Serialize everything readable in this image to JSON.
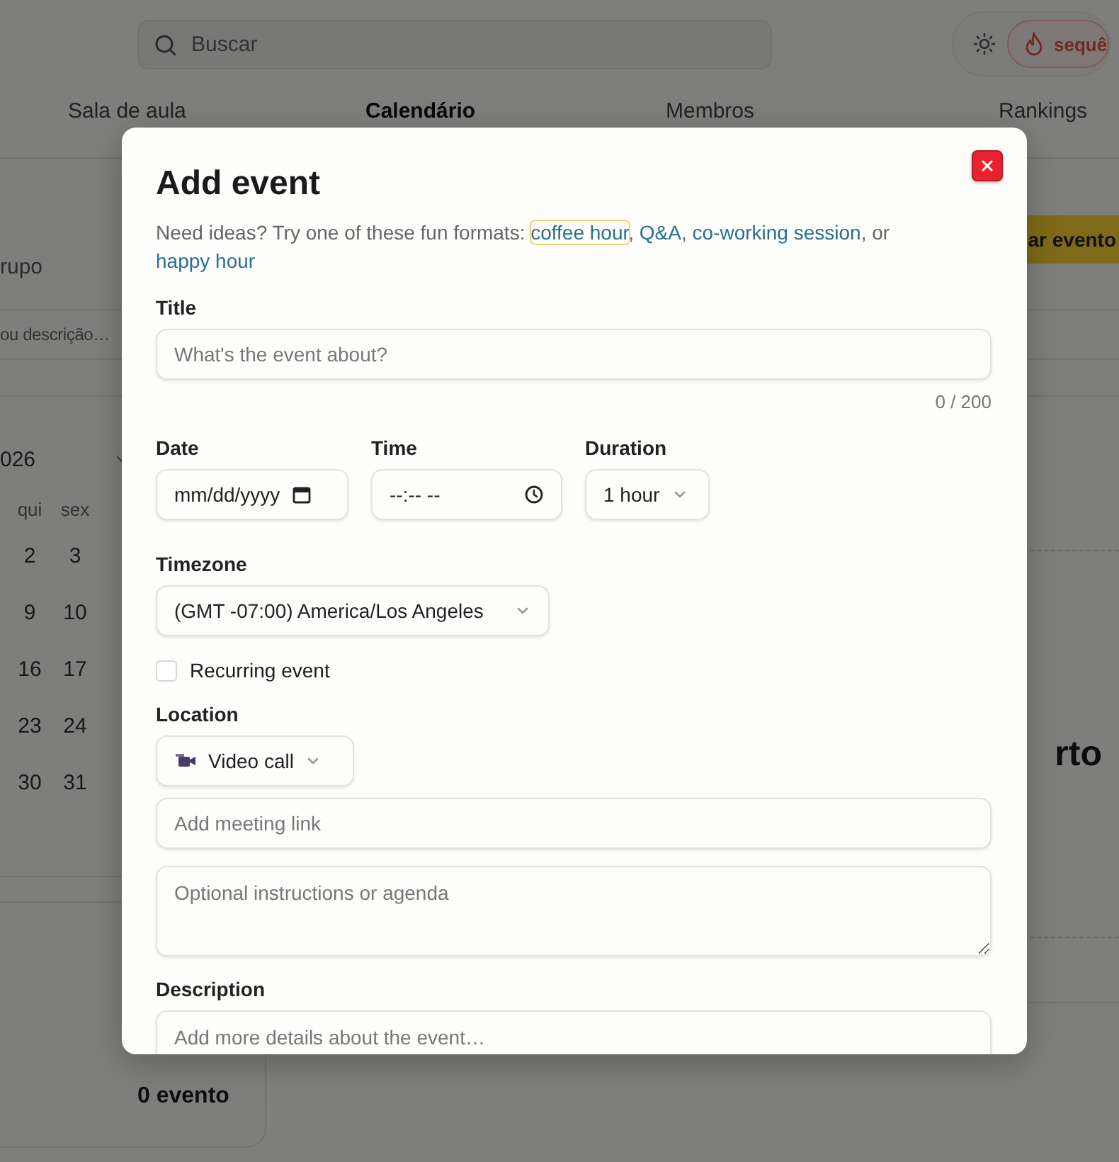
{
  "header": {
    "search": {
      "placeholder": "Buscar"
    },
    "streak": {
      "label": "sequê"
    }
  },
  "tabs": [
    {
      "label": "Sala de aula",
      "selected": false
    },
    {
      "label": "Calendário",
      "selected": true
    },
    {
      "label": "Membros",
      "selected": false
    },
    {
      "label": "Rankings",
      "selected": false
    }
  ],
  "toolbar": {
    "group_label": "rupo",
    "create_button": "ar evento",
    "filter": {
      "placeholder": "ou descrição…"
    }
  },
  "calendar": {
    "month_label": "026",
    "weekdays": [
      "qui",
      "sex"
    ],
    "weeks": [
      [
        "2",
        "3"
      ],
      [
        "9",
        "10"
      ],
      [
        "16",
        "17"
      ],
      [
        "23",
        "24"
      ],
      [
        "30",
        "31"
      ]
    ]
  },
  "events_panel": {
    "heading": "rto"
  },
  "events_count": "0 evento",
  "dialog": {
    "title": "Add event",
    "intro": [
      {
        "kind": "text",
        "text": "Need ideas? Try one of these fun formats: "
      },
      {
        "kind": "link",
        "text": "coffee hour",
        "focused": true
      },
      {
        "kind": "text",
        "text": ", "
      },
      {
        "kind": "link",
        "text": "Q&A",
        "focused": false
      },
      {
        "kind": "text",
        "text": ", "
      },
      {
        "kind": "link",
        "text": "co-working session",
        "focused": false
      },
      {
        "kind": "text",
        "text": ", or "
      },
      {
        "kind": "link",
        "text": "happy hour",
        "focused": false
      }
    ],
    "title_field": {
      "label": "Title",
      "placeholder": "What's the event about?",
      "counter": "0 / 200"
    },
    "date_field": {
      "label": "Date",
      "value": "mm/dd/yyyy"
    },
    "time_field": {
      "label": "Time",
      "value": "--:-- --"
    },
    "duration_field": {
      "label": "Duration",
      "value": "1 hour"
    },
    "timezone_field": {
      "label": "Timezone",
      "value": "(GMT -07:00) America/Los Angeles"
    },
    "recurring": {
      "label": "Recurring event",
      "checked": false
    },
    "location": {
      "label": "Location",
      "type": {
        "value": "Video call"
      },
      "link": {
        "placeholder": "Add meeting link"
      },
      "instructions": {
        "placeholder": "Optional instructions or agenda"
      }
    },
    "description": {
      "label": "Description",
      "placeholder": "Add more details about the event…"
    }
  }
}
